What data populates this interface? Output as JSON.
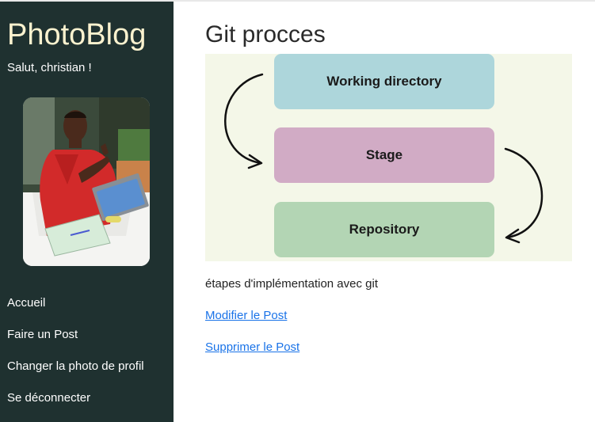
{
  "sidebar": {
    "brand": "PhotoBlog",
    "greeting": "Salut, christian !",
    "nav": [
      {
        "label": "Accueil"
      },
      {
        "label": "Faire un Post"
      },
      {
        "label": "Changer la photo de profil"
      },
      {
        "label": "Se déconnecter"
      }
    ]
  },
  "post": {
    "title": "Git procces",
    "figure": {
      "boxes": [
        "Working directory",
        "Stage",
        "Repository"
      ]
    },
    "caption": "étapes d'implémentation avec git",
    "edit_link": "Modifier le Post",
    "delete_link": "Supprimer le Post"
  },
  "colors": {
    "sidebar_bg": "#1f3130",
    "brand": "#fbf2cf",
    "figure_bg": "#f4f7e8",
    "working_directory": "#add6db",
    "stage": "#d1abc5",
    "repository": "#b3d5b4",
    "link": "#1a73e8"
  }
}
